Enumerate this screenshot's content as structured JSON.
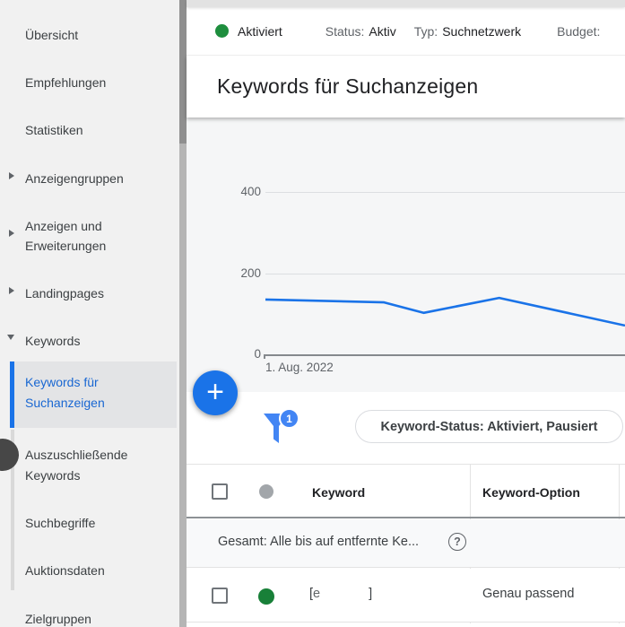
{
  "topbar": {
    "enabled_label": "Aktiviert",
    "status_label": "Status:",
    "status_value": "Aktiv",
    "type_label": "Typ:",
    "type_value": "Suchnetzwerk",
    "budget_label": "Budget:"
  },
  "sidebar": {
    "items": [
      {
        "label": "Übersicht"
      },
      {
        "label": "Empfehlungen"
      },
      {
        "label": "Statistiken"
      },
      {
        "label": "Anzeigengruppen",
        "arrow": "collapsed"
      },
      {
        "label": "Anzeigen und Erweiterungen",
        "arrow": "collapsed"
      },
      {
        "label": "Landingpages",
        "arrow": "collapsed"
      },
      {
        "label": "Keywords",
        "arrow": "expanded"
      }
    ],
    "keywords_children": [
      {
        "label": "Keywords für Suchanzeigen",
        "selected": true
      },
      {
        "label": "Auszuschließende Keywords"
      },
      {
        "label": "Suchbegriffe"
      },
      {
        "label": "Auktionsdaten"
      }
    ],
    "bottom_items": [
      {
        "label": "Zielgruppen"
      }
    ]
  },
  "page": {
    "title": "Keywords für Suchanzeigen"
  },
  "chart_data": {
    "type": "line",
    "title": "",
    "x_tick_labels": [
      "1. Aug. 2022"
    ],
    "x_fractions": [
      0,
      0.33,
      0.44,
      0.65,
      1
    ],
    "values": [
      135,
      128,
      102,
      139,
      71
    ],
    "y_ticks": [
      0,
      200,
      400
    ],
    "ylim": [
      0,
      500
    ],
    "grid": true,
    "legend": "none",
    "line_color": "#1a73e8"
  },
  "fab": {
    "plus": "+"
  },
  "filter": {
    "badge_count": "1",
    "chip_label": "Keyword-Status: Aktiviert, Pausiert"
  },
  "table": {
    "columns": [
      {
        "label": "Keyword"
      },
      {
        "label": "Keyword-Option"
      }
    ],
    "summary_row": {
      "text": "Gesamt: Alle bis auf entfernte Ke...",
      "help_icon": "?"
    },
    "rows": [
      {
        "status": "enabled",
        "keyword_open": "[",
        "keyword_remnant": "e",
        "keyword_close": "]",
        "option": "Genau passend"
      }
    ]
  },
  "colors": {
    "accent_blue": "#1a73e8",
    "selected_nav_text": "#1967d2",
    "enabled_green": "#1e8e3e",
    "row_green": "#188038",
    "chart_line": "#1a73e8"
  }
}
